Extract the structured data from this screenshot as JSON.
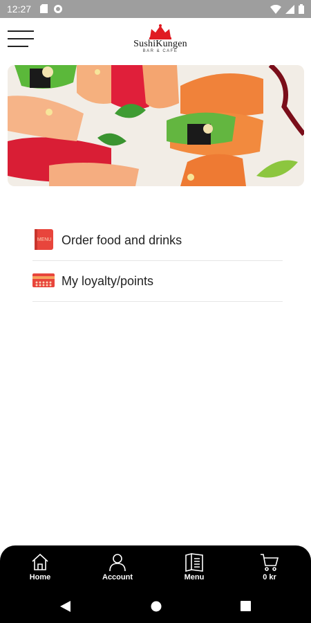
{
  "status_bar": {
    "time": "12:27"
  },
  "header": {
    "logo_text": "SushiKungen",
    "logo_subtext": "BAR & CAFÉ"
  },
  "menu": {
    "items": [
      {
        "label": "Order food and drinks",
        "icon": "menu-book-icon"
      },
      {
        "label": "My loyalty/points",
        "icon": "loyalty-card-icon"
      }
    ]
  },
  "tab_bar": {
    "tabs": [
      {
        "label": "Home",
        "icon": "home-icon"
      },
      {
        "label": "Account",
        "icon": "account-icon"
      },
      {
        "label": "Menu",
        "icon": "menu-icon"
      },
      {
        "label": "0 kr",
        "icon": "cart-icon"
      }
    ]
  },
  "colors": {
    "accent": "#e8453c",
    "tab_bar_bg": "#000000"
  }
}
